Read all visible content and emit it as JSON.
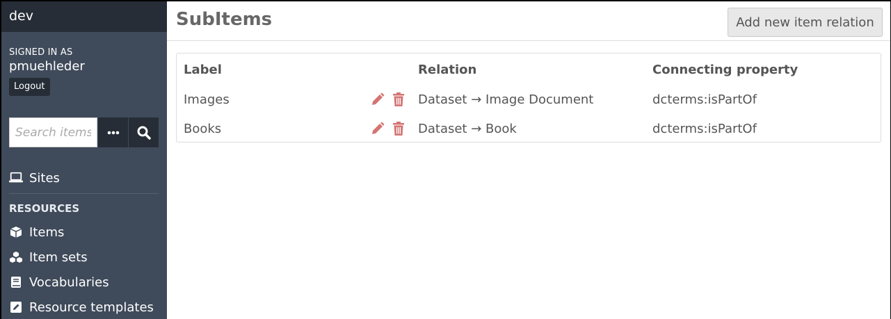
{
  "sidebar": {
    "site_title": "dev",
    "signed_in_label": "SIGNED IN AS",
    "username": "pmuehleder",
    "logout_label": "Logout",
    "search": {
      "placeholder": "Search items"
    },
    "sites_label": "Sites",
    "resources_heading": "RESOURCES",
    "nav_items": [
      {
        "label": "Items",
        "icon": "cube-icon"
      },
      {
        "label": "Item sets",
        "icon": "cubes-icon"
      },
      {
        "label": "Vocabularies",
        "icon": "book-icon"
      },
      {
        "label": "Resource templates",
        "icon": "pencil-square-icon"
      }
    ]
  },
  "main": {
    "title": "SubItems",
    "add_button_label": "Add new item relation",
    "table": {
      "headers": {
        "label": "Label",
        "relation": "Relation",
        "property": "Connecting property"
      },
      "rows": [
        {
          "label": "Images",
          "relation": "Dataset → Image Document",
          "property": "dcterms:isPartOf"
        },
        {
          "label": "Books",
          "relation": "Dataset → Book",
          "property": "dcterms:isPartOf"
        }
      ]
    }
  },
  "colors": {
    "sidebar_bg": "#3f4a5a",
    "sidebar_dark": "#262d37",
    "action_icon": "#d47474"
  }
}
